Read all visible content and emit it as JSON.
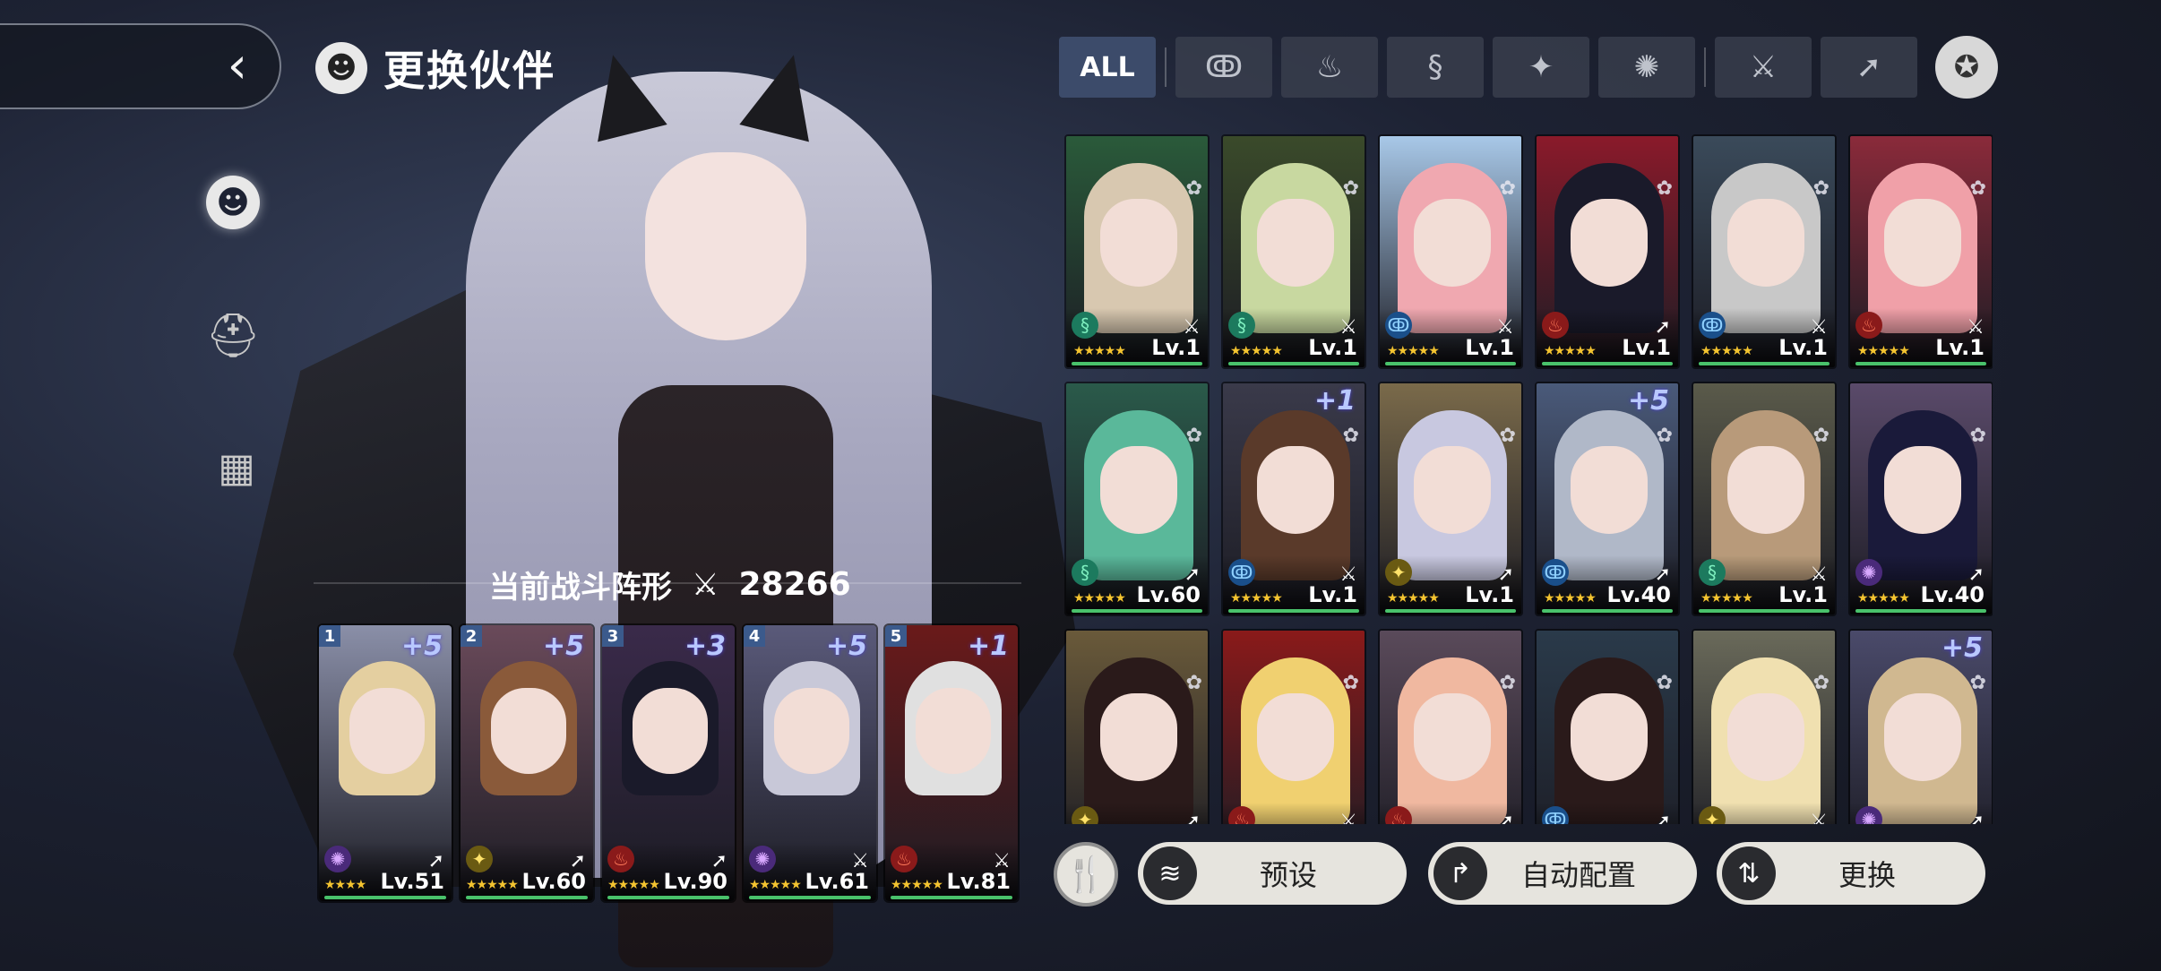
{
  "header": {
    "title": "更换伙伴",
    "back_icon": "chevron-left-icon",
    "title_icon": "companion-head-icon"
  },
  "side_nav": [
    {
      "icon": "companion-head-icon",
      "active": true
    },
    {
      "icon": "helmet-star-icon",
      "active": false
    },
    {
      "icon": "grid-icon",
      "active": false
    }
  ],
  "formation": {
    "label": "当前战斗阵形",
    "icon": "crossed-swords-icon",
    "power": "28266"
  },
  "team": [
    {
      "slot": "1",
      "plus": "+5",
      "element": "dark",
      "weapon": "rifle",
      "stars": "★★★★",
      "level": "Lv.51",
      "bg": "#8a8fa8",
      "hair": "#e4cfa0"
    },
    {
      "slot": "2",
      "plus": "+5",
      "element": "light",
      "weapon": "rifle",
      "stars": "★★★★★",
      "level": "Lv.60",
      "bg": "#6a4a5a",
      "hair": "#8a5a3a"
    },
    {
      "slot": "3",
      "plus": "+3",
      "element": "fire",
      "weapon": "rifle",
      "stars": "★★★★★",
      "level": "Lv.90",
      "bg": "#3a2a4a",
      "hair": "#1a1a2a"
    },
    {
      "slot": "4",
      "plus": "+5",
      "element": "dark",
      "weapon": "sword",
      "stars": "★★★★★",
      "level": "Lv.61",
      "bg": "#5a5a7a",
      "hair": "#c8c8d8"
    },
    {
      "slot": "5",
      "plus": "+1",
      "element": "fire",
      "weapon": "sword",
      "stars": "★★★★★",
      "level": "Lv.81",
      "bg": "#6a1a1a",
      "hair": "#e0e0e0"
    }
  ],
  "filters": {
    "all_label": "ALL",
    "elements": [
      {
        "icon": "water-icon",
        "glyph": "ↂ"
      },
      {
        "icon": "fire-icon",
        "glyph": "♨"
      },
      {
        "icon": "wind-icon",
        "glyph": "§"
      },
      {
        "icon": "light-icon",
        "glyph": "✦"
      },
      {
        "icon": "dark-icon",
        "glyph": "✺"
      }
    ],
    "weapons": [
      {
        "icon": "sword-icon",
        "glyph": "⚔"
      },
      {
        "icon": "rifle-icon",
        "glyph": "➚"
      }
    ],
    "medal_icon": "medal-icon"
  },
  "roster": [
    {
      "element": "wind",
      "weapon": "sword",
      "stars": "★★★★★",
      "level": "Lv.1",
      "plus": "",
      "bg": "#2a5a3a",
      "hair": "#d8c8b0"
    },
    {
      "element": "wind",
      "weapon": "sword",
      "stars": "★★★★★",
      "level": "Lv.1",
      "plus": "",
      "bg": "#3a4a2a",
      "hair": "#c8d8a0"
    },
    {
      "element": "water",
      "weapon": "sword",
      "stars": "★★★★★",
      "level": "Lv.1",
      "plus": "",
      "bg": "#a8c8e8",
      "hair": "#f0a8b0"
    },
    {
      "element": "fire",
      "weapon": "rifle",
      "stars": "★★★★★",
      "level": "Lv.1",
      "plus": "",
      "bg": "#8a1a2a",
      "hair": "#1a1a2a"
    },
    {
      "element": "water",
      "weapon": "sword",
      "stars": "★★★★★",
      "level": "Lv.1",
      "plus": "",
      "bg": "#3a4a5a",
      "hair": "#c8c8c8"
    },
    {
      "element": "fire",
      "weapon": "sword",
      "stars": "★★★★★",
      "level": "Lv.1",
      "plus": "",
      "bg": "#8a2a3a",
      "hair": "#f0a0a8"
    },
    {
      "element": "wind",
      "weapon": "rifle",
      "stars": "★★★★★",
      "level": "Lv.60",
      "plus": "",
      "bg": "#2a5a4a",
      "hair": "#5ab89a"
    },
    {
      "element": "water",
      "weapon": "sword",
      "stars": "★★★★★",
      "level": "Lv.1",
      "plus": "+1",
      "bg": "#3a3a4a",
      "hair": "#5a3a2a"
    },
    {
      "element": "light",
      "weapon": "rifle",
      "stars": "★★★★★",
      "level": "Lv.1",
      "plus": "",
      "bg": "#7a6a4a",
      "hair": "#c8c8e0"
    },
    {
      "element": "water",
      "weapon": "rifle",
      "stars": "★★★★★",
      "level": "Lv.40",
      "plus": "+5",
      "bg": "#4a5a7a",
      "hair": "#b0b8c8"
    },
    {
      "element": "wind",
      "weapon": "sword",
      "stars": "★★★★★",
      "level": "Lv.1",
      "plus": "",
      "bg": "#5a5a4a",
      "hair": "#b89a7a"
    },
    {
      "element": "dark",
      "weapon": "rifle",
      "stars": "★★★★★",
      "level": "Lv.40",
      "plus": "",
      "bg": "#5a4a6a",
      "hair": "#1a1a3a"
    },
    {
      "element": "light",
      "weapon": "rifle",
      "stars": "★★★★★",
      "level": "",
      "plus": "",
      "bg": "#6a5a3a",
      "hair": "#2a1a1a"
    },
    {
      "element": "fire",
      "weapon": "sword",
      "stars": "★★★★★",
      "level": "",
      "plus": "",
      "bg": "#8a1a1a",
      "hair": "#f0d070"
    },
    {
      "element": "fire",
      "weapon": "rifle",
      "stars": "★★★★★",
      "level": "",
      "plus": "",
      "bg": "#5a4a5a",
      "hair": "#f0b8a0"
    },
    {
      "element": "water",
      "weapon": "rifle",
      "stars": "★★★★★",
      "level": "",
      "plus": "",
      "bg": "#2a3a4a",
      "hair": "#2a1a1a"
    },
    {
      "element": "light",
      "weapon": "sword",
      "stars": "★★★★★",
      "level": "",
      "plus": "",
      "bg": "#6a6a5a",
      "hair": "#f0e0b0"
    },
    {
      "element": "dark",
      "weapon": "rifle",
      "stars": "★★★★★",
      "level": "",
      "plus": "+5",
      "bg": "#4a4a6a",
      "hair": "#d0b890"
    }
  ],
  "buttons": {
    "food_icon": "fork-knife-icon",
    "preset": {
      "label": "预设",
      "icon": "layers-icon"
    },
    "auto": {
      "label": "自动配置",
      "icon": "auto-arrow-icon"
    },
    "swap": {
      "label": "更换",
      "icon": "swap-arrows-icon"
    }
  },
  "colors": {
    "accent_active_tab": "#3c4b6a",
    "exp_bar": "#49c26b",
    "star": "#f4c430",
    "plus_text": "#b9c8ff"
  }
}
